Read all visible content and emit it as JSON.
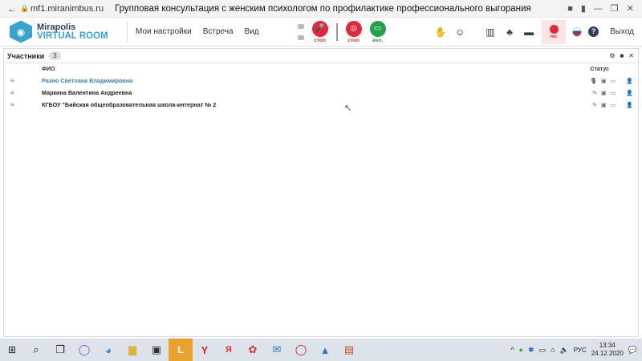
{
  "browser": {
    "url": "mf1.miranimbus.ru",
    "title": "Групповая консультация с женским психологом по профилактике профессионального выгорания для педаг..."
  },
  "app": {
    "logo_line1": "Mirapolis",
    "logo_line2": "VIRTUAL ROOM",
    "menu": [
      "Мои настройки",
      "Встреча",
      "Вид"
    ],
    "mic_label": "стоп",
    "cam_label": "стоп",
    "screen_label": "вкл.",
    "rec_label": "rec",
    "exit_label": "Выход"
  },
  "participants": {
    "title": "Участники",
    "count": "3",
    "col_name": "ФИО",
    "col_status": "Статус",
    "rows": [
      {
        "name": "Рахно Светлана  Владимировна",
        "highlight": true
      },
      {
        "name": "Маркина Валентина  Андреевна",
        "highlight": false
      },
      {
        "name": "КГБОУ \"Бийская общеобразовательная школа-интернат № 2",
        "highlight": false
      }
    ]
  },
  "taskbar": {
    "lang": "РУС",
    "time": "13:34",
    "date": "24.12.2020"
  }
}
